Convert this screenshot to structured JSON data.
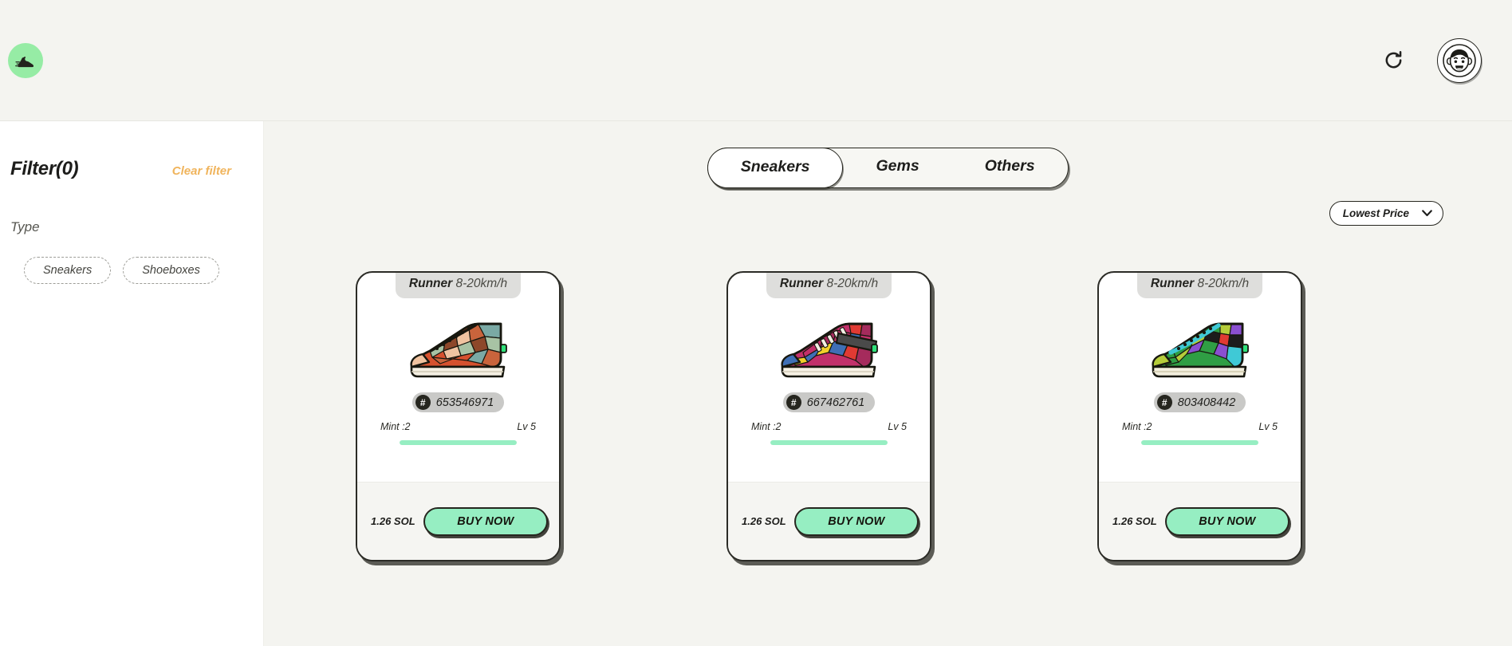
{
  "header": {
    "logo_icon": "sneaker-logo-icon",
    "refresh_icon": "refresh-icon",
    "avatar_icon": "user-avatar-icon"
  },
  "sidebar": {
    "filter_title": "Filter(0)",
    "clear_filter_label": "Clear filter",
    "type_label": "Type",
    "type_chips": [
      {
        "label": "Sneakers"
      },
      {
        "label": "Shoeboxes"
      }
    ]
  },
  "main": {
    "tabs": [
      {
        "label": "Sneakers",
        "active": true
      },
      {
        "label": "Gems",
        "active": false
      },
      {
        "label": "Others",
        "active": false
      }
    ],
    "sort": {
      "selected": "Lowest Price",
      "chevron_icon": "chevron-down-icon",
      "options": [
        "Lowest Price"
      ]
    },
    "cards": [
      {
        "type": "Runner",
        "speed": "8-20km/h",
        "id": "653546971",
        "hash_symbol": "#",
        "mint": "Mint :2",
        "level": "Lv 5",
        "durability_percent": 100,
        "price": "1.26 SOL",
        "buy_label": "BUY NOW",
        "shoe_palette": {
          "a": "#d6512e",
          "b": "#a8c3a4",
          "c": "#7aa9a4",
          "d": "#f0c3a0",
          "e": "#8d472a",
          "f": "#c9643c",
          "g": "#f4efe2"
        }
      },
      {
        "type": "Runner",
        "speed": "8-20km/h",
        "id": "667462761",
        "hash_symbol": "#",
        "mint": "Mint :2",
        "level": "Lv 5",
        "durability_percent": 100,
        "price": "1.26 SOL",
        "buy_label": "BUY NOW",
        "shoe_palette": {
          "a": "#c2306a",
          "b": "#3f6fb5",
          "c": "#f2cf2a",
          "d": "#e03a33",
          "e": "#4a4a4a",
          "f": "#a52b5c",
          "g": "#f6f1e4"
        }
      },
      {
        "type": "Runner",
        "speed": "8-20km/h",
        "id": "803408442",
        "hash_symbol": "#",
        "mint": "Mint :2",
        "level": "Lv 5",
        "durability_percent": 100,
        "price": "1.26 SOL",
        "buy_label": "BUY NOW",
        "shoe_palette": {
          "a": "#3fc9d6",
          "b": "#2f9e44",
          "c": "#8a4fd0",
          "d": "#e03a33",
          "e": "#1c1c1c",
          "f": "#b5cc3a",
          "g": "#f2eedd"
        }
      }
    ]
  },
  "colors": {
    "page_bg": "#f4f4f0",
    "sidebar_bg": "#ffffff",
    "accent_green": "#96eca5",
    "button_green": "#96eec2",
    "accent_orange": "#f0b45c",
    "ink": "#26261f"
  }
}
